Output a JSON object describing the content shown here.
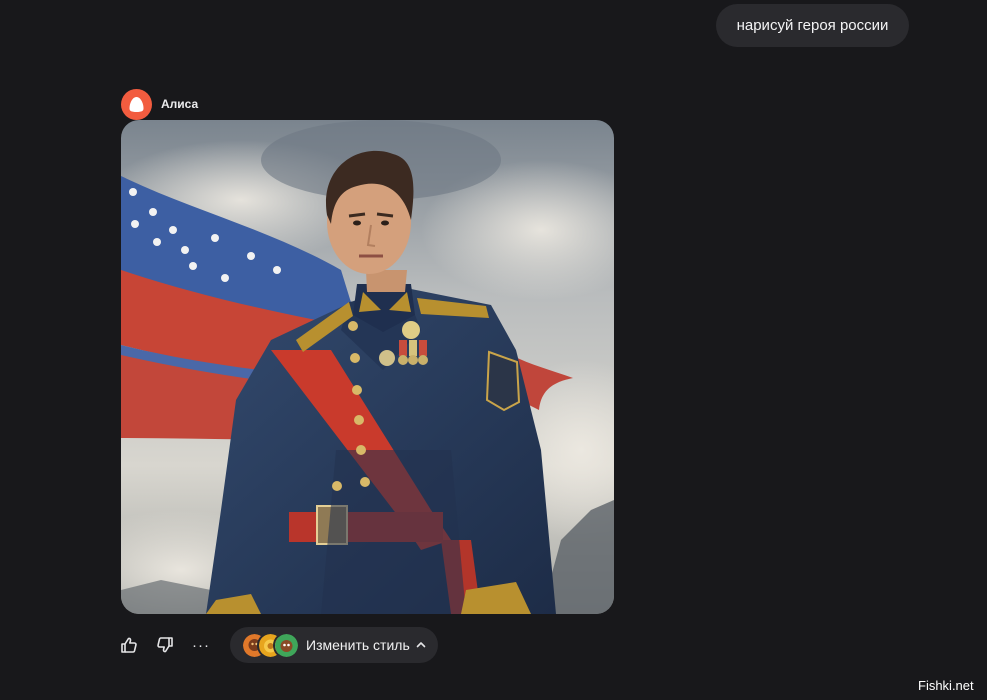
{
  "user_message": {
    "text": "нарисуй героя россии"
  },
  "assistant": {
    "name": "Алиса"
  },
  "actions": {
    "like_icon": "thumbs-up-icon",
    "dislike_icon": "thumbs-down-icon",
    "more_label": "···",
    "style_button_label": "Изменить стиль",
    "style_chevron_icon": "chevron-up-icon"
  },
  "watermark": {
    "text": "Fishki.net"
  },
  "colors": {
    "background": "#18181b",
    "bubble": "#2a2a2e",
    "alice_accent": "#f25c3f"
  }
}
